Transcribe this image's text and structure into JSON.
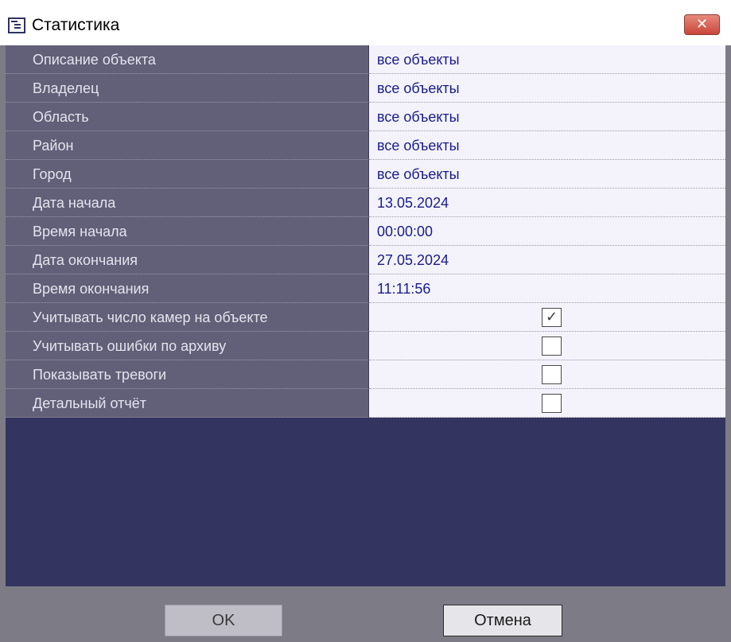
{
  "window": {
    "title": "Статистика",
    "close_label": "✕"
  },
  "properties": [
    {
      "label": "Описание объекта",
      "value": "все объекты"
    },
    {
      "label": "Владелец",
      "value": "все объекты"
    },
    {
      "label": "Область",
      "value": "все объекты"
    },
    {
      "label": "Район",
      "value": "все объекты"
    },
    {
      "label": "Город",
      "value": "все объекты"
    },
    {
      "label": "Дата начала",
      "value": "13.05.2024"
    },
    {
      "label": "Время начала",
      "value": "00:00:00"
    },
    {
      "label": "Дата окончания",
      "value": "27.05.2024"
    },
    {
      "label": "Время окончания",
      "value": "11:11:56"
    }
  ],
  "options": [
    {
      "label": "Учитывать число камер на объекте",
      "checked": true
    },
    {
      "label": "Учитывать ошибки по архиву",
      "checked": false
    },
    {
      "label": "Показывать тревоги",
      "checked": false
    },
    {
      "label": "Детальный отчёт",
      "checked": false
    }
  ],
  "buttons": {
    "ok_label": "OK",
    "cancel_label": "Отмена"
  }
}
